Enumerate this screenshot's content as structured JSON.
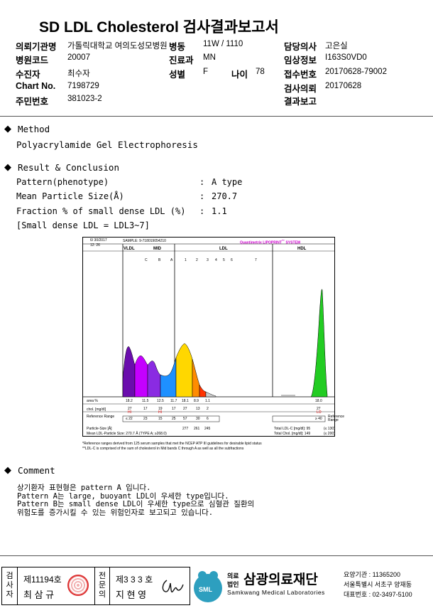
{
  "report": {
    "title": "SD LDL Cholesterol 검사결과보고서"
  },
  "header": {
    "institution_label": "의뢰기관명",
    "institution_value": "가톨릭대학교 여의도성모병원",
    "ward_label": "병동",
    "ward_value": "11W / 1110",
    "doctor_label": "담당의사",
    "doctor_value": "고은실",
    "hospital_code_label": "병원코드",
    "hospital_code_value": "20007",
    "dept_label": "진료과",
    "dept_value": "MN",
    "clinical_info_label": "임상정보",
    "clinical_info_value": "I163S0VD0",
    "patient_label": "수진자",
    "patient_value": "최수자",
    "sex_label": "성별",
    "sex_value": "F",
    "age_label": "나이",
    "age_value": "78",
    "receipt_label": "접수번호",
    "receipt_value": "20170628-79002",
    "chart_label": "Chart No.",
    "chart_value": "7198729",
    "request_label": "검사의뢰",
    "request_value": "20170628",
    "resident_label": "주민번호",
    "resident_value": "381023-2",
    "report_label": "결과보고",
    "report_value": ""
  },
  "method": {
    "heading": "Method",
    "text": "Polyacrylamide Gel Electrophoresis"
  },
  "result": {
    "heading": "Result & Conclusion",
    "rows": [
      {
        "label": "Pattern(phenotype)",
        "sep": ":",
        "value": "A type"
      },
      {
        "label": "Mean Particle Size(Å)",
        "sep": ":",
        "value": "270.7"
      },
      {
        "label": "Fraction % of small dense LDL (%)",
        "sep": ":",
        "value": "1.1"
      }
    ],
    "note": "[Small dense LDL = LDL3~7]"
  },
  "chart": {
    "date": "6/ 30/2017",
    "time": "12: 26",
    "sample": "SAMPLE:  9-718019054210",
    "brand": "Quantimetrix LIPOPRINT",
    "brand_sup": "™",
    "brand_tail": " SYSTEM",
    "band_vldl": "VLDL",
    "band_mid": "MID",
    "band_ldl": "LDL",
    "band_hdl": "HDL",
    "mid_labels": [
      "C",
      "B",
      "A"
    ],
    "ldl_labels": [
      "1",
      "2",
      "3",
      "4",
      "5",
      "6",
      "7"
    ],
    "row_area": "area %",
    "row_chol": "chol. [mg/dl]",
    "row_ref": "Reference Range",
    "area_values": [
      "18.2",
      "11.5",
      "12.5",
      "11.7",
      "18.1",
      "8.9",
      "1.1",
      "18.0"
    ],
    "chol_values": [
      "27",
      "17",
      "19",
      "17",
      "27",
      "13",
      "2",
      "27"
    ],
    "hi_flags": [
      "HI",
      "",
      "HI",
      "",
      "",
      "",
      "",
      ""
    ],
    "lo_flag": "LO",
    "ref_values": [
      "≤ 22",
      "23",
      "15",
      "25",
      "57",
      "30",
      "6",
      "≥ 40"
    ],
    "ref_right": "Reference Range",
    "particle_size_label": "Particle-Size [Å]",
    "particle_sizes": [
      "277",
      "261",
      "245"
    ],
    "mean_size_label": "Mean LDL-Particle Size:  270.7 Å  (TYPE A; ≥268.0)",
    "total_ldl_label": "Total LDL-C [mg/dl]:  95",
    "total_ldl_ref": "(≤ 130)",
    "total_chol_label": "Total Chol. [mg/dl]:  149",
    "total_chol_ref": "(≤ 200)",
    "footnote1": "*Reference ranges derived from 125 serum samples that met the NCEP ATP III guidelines for desirable lipid status",
    "footnote2": "**LDL-C is comprised of the sum of cholesterol in Mid bands C through A as well as all the subfractions"
  },
  "comment": {
    "heading": "Comment",
    "lines": [
      "상기환자 표현형은 pattern A 입니다.",
      "Pattern A는 large, buoyant LDL이 우세한 type입니다.",
      "Pattern B는 small dense LDL이 우세한 type으로 심혈관 질환의",
      "위험도를 증가시킬 수 있는 위험인자로 보고되고 있습니다."
    ]
  },
  "footer": {
    "inspector_label": [
      "검",
      "사",
      "자"
    ],
    "inspector_no": "제11194호",
    "inspector_name": "최 삼 규",
    "reviewer_label": [
      "전",
      "문",
      "의"
    ],
    "reviewer_no": "제3 3 3 호",
    "reviewer_name": "지 현 영",
    "org_prefix_top": "의료",
    "org_prefix_bottom": "법인",
    "org_name": "삼광의료재단",
    "org_english": "Samkwang Medical Laboratories",
    "logo_text": "SML",
    "code_label": "요양기관 : 11365200",
    "address": "서울특별시 서초구 양재동",
    "phone": "대표번호 : 02-3497-5100"
  },
  "colors": {
    "vldl": "#6a0dad",
    "midC": "#c400ff",
    "midB": "#8a2be2",
    "midA": "#1e90ff",
    "ldl1": "#ffd700",
    "ldl2": "#ff8c00",
    "ldl3": "#ff3300",
    "hdl": "#22cc22",
    "brand": "#cc00cc"
  }
}
